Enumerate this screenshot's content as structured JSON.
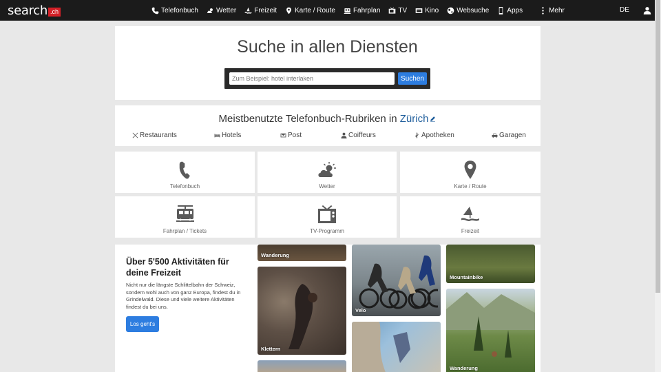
{
  "topbar": {
    "logo_word": "search",
    "logo_badge": ".ch",
    "nav": [
      {
        "label": "Telefonbuch",
        "icon": "phone-icon"
      },
      {
        "label": "Wetter",
        "icon": "weather-icon"
      },
      {
        "label": "Freizeit",
        "icon": "leisure-icon"
      },
      {
        "label": "Karte / Route",
        "icon": "map-pin-icon"
      },
      {
        "label": "Fahrplan",
        "icon": "train-icon"
      },
      {
        "label": "TV",
        "icon": "tv-icon"
      },
      {
        "label": "Kino",
        "icon": "cinema-icon"
      },
      {
        "label": "Websuche",
        "icon": "globe-icon"
      },
      {
        "label": "Apps",
        "icon": "phone-device-icon"
      },
      {
        "label": "Mehr",
        "icon": "more-dots-icon"
      }
    ],
    "language": "DE",
    "accent": "#d42027"
  },
  "search": {
    "title": "Suche in allen Diensten",
    "placeholder": "Zum Beispiel: hotel interlaken",
    "button_label": "Suchen",
    "button_color": "#2d7de0"
  },
  "rubriken": {
    "title_prefix": "Meistbenutzte Telefonbuch-Rubriken in",
    "city": "Zürich",
    "items": [
      {
        "label": "Restaurants",
        "icon": "cutlery-icon"
      },
      {
        "label": "Hotels",
        "icon": "bed-icon"
      },
      {
        "label": "Post",
        "icon": "envelope-icon"
      },
      {
        "label": "Coiffeurs",
        "icon": "person-icon"
      },
      {
        "label": "Apotheken",
        "icon": "pharmacy-icon"
      },
      {
        "label": "Garagen",
        "icon": "car-icon"
      }
    ]
  },
  "tiles": [
    {
      "label": "Telefonbuch",
      "icon": "phone-icon"
    },
    {
      "label": "Wetter",
      "icon": "weather-icon"
    },
    {
      "label": "Karte / Route",
      "icon": "map-pin-icon"
    },
    {
      "label": "Fahrplan / Tickets",
      "icon": "train-icon"
    },
    {
      "label": "TV-Programm",
      "icon": "tv-icon"
    },
    {
      "label": "Freizeit",
      "icon": "leisure-icon"
    }
  ],
  "activities": {
    "title": "Über 5'500 Aktivitäten für deine Freizeit",
    "text": "Nicht nur die längste Schlittelbahn der Schweiz, sondern wohl auch von ganz Europa, findest du in Grindelwald. Diese und viele weitere Aktivitäten findest du bei uns.",
    "button_label": "Los geht's",
    "photos": [
      "Wanderung",
      "Klettern",
      "Velo",
      "Mountainbike",
      "Wanderung"
    ]
  }
}
